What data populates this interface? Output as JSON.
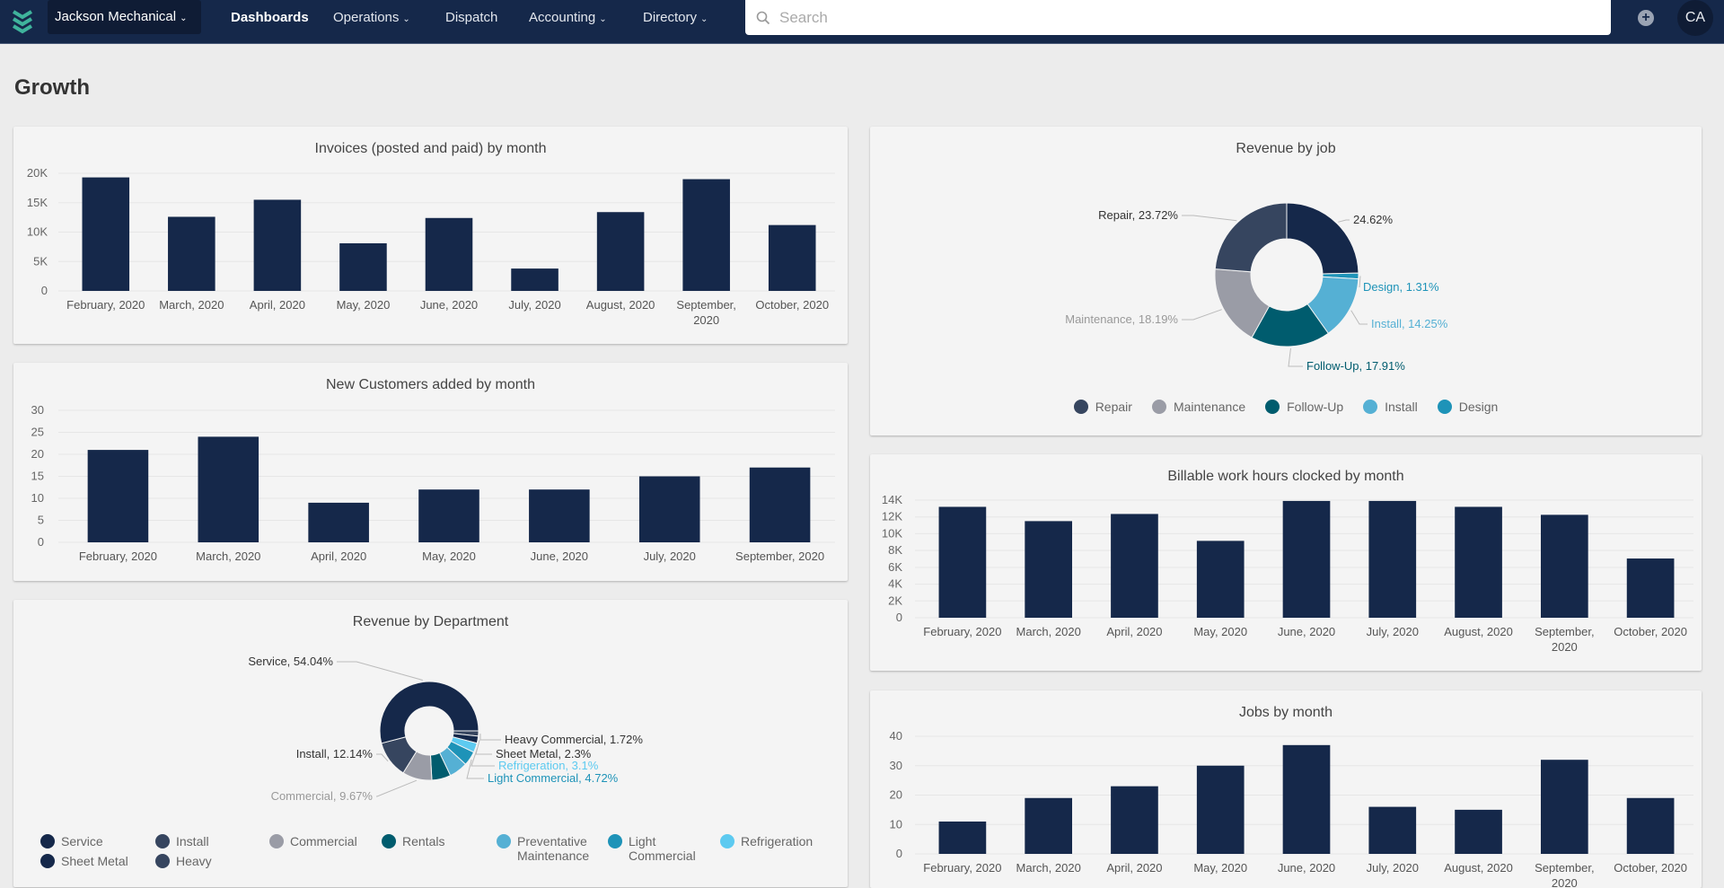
{
  "nav": {
    "company": "Jackson Mechanical",
    "items": [
      {
        "label": "Dashboards",
        "dropdown": false,
        "active": true
      },
      {
        "label": "Operations",
        "dropdown": true
      },
      {
        "label": "Dispatch",
        "dropdown": false
      },
      {
        "label": "Accounting",
        "dropdown": true
      },
      {
        "label": "Directory",
        "dropdown": true
      }
    ],
    "search_placeholder": "Search",
    "avatar_initials": "CA",
    "icons": [
      "logo-chevrons-icon",
      "search-icon",
      "plus-circle-icon"
    ]
  },
  "page": {
    "title": "Growth"
  },
  "colors": {
    "nav": "#15284a",
    "bar": "#15284a"
  },
  "chart_data": [
    {
      "id": "invoices",
      "type": "bar",
      "title": "Invoices (posted and paid) by month",
      "categories": [
        "February, 2020",
        "March, 2020",
        "April, 2020",
        "May, 2020",
        "June, 2020",
        "July, 2020",
        "August, 2020",
        "September, 2020",
        "October, 2020"
      ],
      "values": [
        19300,
        12600,
        15500,
        8100,
        12400,
        3800,
        13400,
        19000,
        11200
      ],
      "yticks": [
        0,
        5000,
        10000,
        15000,
        20000
      ],
      "ytick_labels": [
        "0",
        "5K",
        "10K",
        "15K",
        "20K"
      ],
      "ylim": [
        0,
        20000
      ],
      "grid": true
    },
    {
      "id": "customers",
      "type": "bar",
      "title": "New Customers added by month",
      "categories": [
        "February, 2020",
        "March, 2020",
        "April, 2020",
        "May, 2020",
        "June, 2020",
        "July, 2020",
        "September, 2020"
      ],
      "values": [
        21,
        24,
        9,
        12,
        12,
        15,
        17
      ],
      "yticks": [
        0,
        5,
        10,
        15,
        20,
        25,
        30
      ],
      "ytick_labels": [
        "0",
        "5",
        "10",
        "15",
        "20",
        "25",
        "30"
      ],
      "ylim": [
        0,
        30
      ],
      "grid": true
    },
    {
      "id": "department",
      "type": "pie",
      "title": "Revenue by Department",
      "slices": [
        {
          "name": "Heavy Commercial",
          "value": 1.72,
          "label": "Heavy Commercial, 1.72%",
          "color": "#36455f"
        },
        {
          "name": "Sheet Metal",
          "value": 2.3,
          "label": "Sheet Metal, 2.3%",
          "color": "#15284a"
        },
        {
          "name": "Refrigeration",
          "value": 3.1,
          "label": "Refrigeration, 3.1%",
          "color": "#5dcaf0"
        },
        {
          "name": "Light Commercial",
          "value": 4.72,
          "label": "Light Commercial, 4.72%",
          "color": "#1e93b8"
        },
        {
          "name": "Preventative Maintenance",
          "value": 6.1,
          "label": "",
          "color": "#55b0d4"
        },
        {
          "name": "Rentals",
          "value": 6.21,
          "label": "",
          "color": "#005c6e"
        },
        {
          "name": "Commercial",
          "value": 9.67,
          "label": "Commercial, 9.67%",
          "color": "#9a9ca6"
        },
        {
          "name": "Install",
          "value": 12.14,
          "label": "Install, 12.14%",
          "color": "#36455f"
        },
        {
          "name": "Service",
          "value": 54.04,
          "label": "Service, 54.04%",
          "color": "#15284a"
        }
      ],
      "legend": [
        {
          "label": "Service",
          "color": "#15284a"
        },
        {
          "label": "Install",
          "color": "#36455f"
        },
        {
          "label": "Commercial",
          "color": "#9a9ca6"
        },
        {
          "label": "Rentals",
          "color": "#005c6e"
        },
        {
          "label": "Preventative Maintenance",
          "color": "#55b0d4"
        },
        {
          "label": "Light Commercial",
          "color": "#1e93b8"
        },
        {
          "label": "Refrigeration",
          "color": "#5dcaf0"
        },
        {
          "label": "Sheet Metal",
          "color": "#15284a"
        },
        {
          "label": "Heavy",
          "color": "#36455f"
        }
      ]
    },
    {
      "id": "job",
      "type": "pie",
      "title": "Revenue by job",
      "slices": [
        {
          "name": "",
          "value": 24.62,
          "label": "24.62%",
          "color": "#15284a"
        },
        {
          "name": "Design",
          "value": 1.31,
          "label": "Design, 1.31%",
          "color": "#1e93b8"
        },
        {
          "name": "Install",
          "value": 14.25,
          "label": "Install, 14.25%",
          "color": "#55b0d4"
        },
        {
          "name": "Follow-Up",
          "value": 17.91,
          "label": "Follow-Up, 17.91%",
          "color": "#005c6e"
        },
        {
          "name": "Maintenance",
          "value": 18.19,
          "label": "Maintenance, 18.19%",
          "color": "#9a9ca6"
        },
        {
          "name": "Repair",
          "value": 23.72,
          "label": "Repair, 23.72%",
          "color": "#36455f"
        }
      ],
      "legend": [
        {
          "label": "Repair",
          "color": "#36455f"
        },
        {
          "label": "Maintenance",
          "color": "#9a9ca6"
        },
        {
          "label": "Follow-Up",
          "color": "#005c6e"
        },
        {
          "label": "Install",
          "color": "#55b0d4"
        },
        {
          "label": "Design",
          "color": "#1e93b8"
        }
      ]
    },
    {
      "id": "billable",
      "type": "bar",
      "title": "Billable work hours clocked by month",
      "categories": [
        "February, 2020",
        "March, 2020",
        "April, 2020",
        "May, 2020",
        "June, 2020",
        "July, 2020",
        "August, 2020",
        "September, 2020",
        "October, 2020"
      ],
      "values": [
        13200,
        11500,
        12350,
        9150,
        13900,
        13900,
        13200,
        12250,
        7050
      ],
      "yticks": [
        0,
        2000,
        4000,
        6000,
        8000,
        10000,
        12000,
        14000
      ],
      "ytick_labels": [
        "0",
        "2K",
        "4K",
        "6K",
        "8K",
        "10K",
        "12K",
        "14K"
      ],
      "ylim": [
        0,
        14000
      ],
      "grid": true
    },
    {
      "id": "jobs",
      "type": "bar",
      "title": "Jobs by month",
      "categories": [
        "February, 2020",
        "March, 2020",
        "April, 2020",
        "May, 2020",
        "June, 2020",
        "July, 2020",
        "August, 2020",
        "September, 2020",
        "October, 2020"
      ],
      "values": [
        11,
        19,
        23,
        30,
        37,
        16,
        15,
        32,
        19
      ],
      "yticks": [
        0,
        10,
        20,
        30,
        40
      ],
      "ytick_labels": [
        "0",
        "10",
        "20",
        "30",
        "40"
      ],
      "ylim": [
        0,
        40
      ],
      "grid": true
    }
  ]
}
